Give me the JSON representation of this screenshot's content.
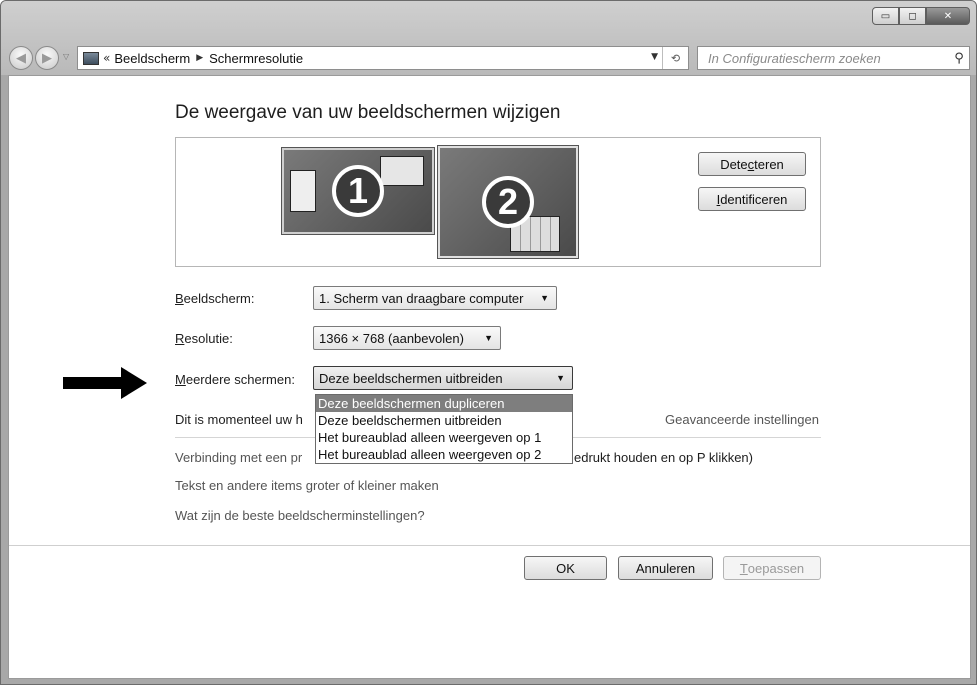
{
  "window": {
    "minimize_glyph": "▭",
    "maximize_glyph": "◻",
    "close_glyph": "✕"
  },
  "nav": {
    "back_glyph": "◀",
    "forward_glyph": "▶",
    "history_glyph": "▽"
  },
  "address": {
    "chevron": "«",
    "crumbs": [
      "Beeldscherm",
      "Schermresolutie"
    ],
    "dropdown_glyph": "▼",
    "refresh_glyph": "⟲"
  },
  "search": {
    "placeholder": "In Configuratiescherm zoeken",
    "icon": "search-icon"
  },
  "main": {
    "heading": "De weergave van uw beeldschermen wijzigen",
    "monitors": [
      "1",
      "2"
    ],
    "detect_label_pre": "Dete",
    "detect_label_u": "c",
    "detect_label_post": "teren",
    "identify_label_u": "I",
    "identify_label_post": "dentificeren"
  },
  "fields": {
    "display": {
      "label_u": "B",
      "label_post": "eeldscherm:",
      "value": "1. Scherm van draagbare computer"
    },
    "resolution": {
      "label_u": "R",
      "label_post": "esolutie:",
      "value": "1366 × 768 (aanbevolen)"
    },
    "multiple": {
      "label_u": "M",
      "label_post": "eerdere schermen:",
      "value": "Deze beeldschermen uitbreiden",
      "options": [
        "Deze beeldschermen dupliceren",
        "Deze beeldschermen uitbreiden",
        "Het bureaublad alleen weergeven op 1",
        "Het bureaublad alleen weergeven op 2"
      ]
    }
  },
  "info": {
    "status": "Dit is momenteel uw h",
    "advanced": "Geavanceerde instellingen",
    "link_projector": "Verbinding met een pr",
    "link_projector_tail": "edrukt houden en op P klikken)",
    "link_text_size": "Tekst en andere items groter of kleiner maken",
    "link_best_settings": "Wat zijn de beste beeldscherminstellingen?"
  },
  "footer": {
    "ok": "OK",
    "cancel": "Annuleren",
    "apply_u": "T",
    "apply_post": "oepassen"
  },
  "colors": {
    "selection": "#7e7e7e",
    "link": "#555555"
  }
}
